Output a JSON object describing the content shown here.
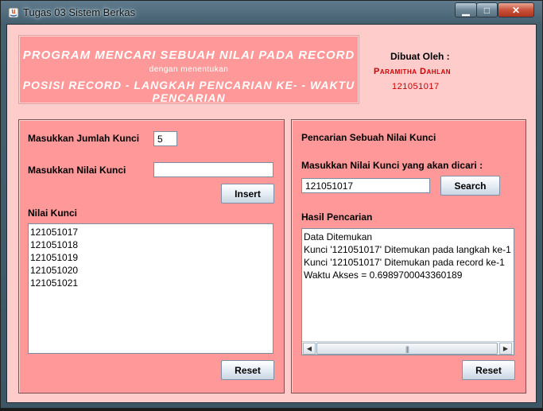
{
  "window": {
    "title": "Tugas 03 Sistem Berkas",
    "min_glyph": "▁",
    "max_glyph": "□",
    "close_glyph": "✕"
  },
  "header": {
    "title": "PROGRAM MENCARI SEBUAH NILAI PADA RECORD",
    "subtitle": "dengan menentukan",
    "info": "POSISI RECORD - LANGKAH PENCARIAN KE- - WAKTU PENCARIAN",
    "author_label": "Dibuat Oleh :",
    "author_name": "Paramitha Dahlan",
    "author_nim": "121051017"
  },
  "left_panel": {
    "jumlah_label": "Masukkan Jumlah Kunci",
    "jumlah_value": "5",
    "nilai_label": "Masukkan Nilai Kunci",
    "nilai_value": "",
    "insert_label": "Insert",
    "list_label": "Nilai Kunci",
    "keys": [
      "121051017",
      "121051018",
      "121051019",
      "121051020",
      "121051021"
    ],
    "reset_label": "Reset"
  },
  "right_panel": {
    "title": "Pencarian Sebuah Nilai Kunci",
    "search_label": "Masukkan Nilai Kunci yang akan dicari :",
    "search_value": "121051017",
    "search_button": "Search",
    "result_label": "Hasil Pencarian",
    "results": [
      "Data Ditemukan",
      "Kunci '121051017' Ditemukan pada langkah ke-1",
      "Kunci '121051017' Ditemukan pada record ke-1",
      "Waktu Akses = 0.6989700043360189"
    ],
    "reset_label": "Reset"
  },
  "colors": {
    "client_bg": "#ffcccc",
    "panel_bg": "#ff9999",
    "author_red": "#cc0000"
  }
}
